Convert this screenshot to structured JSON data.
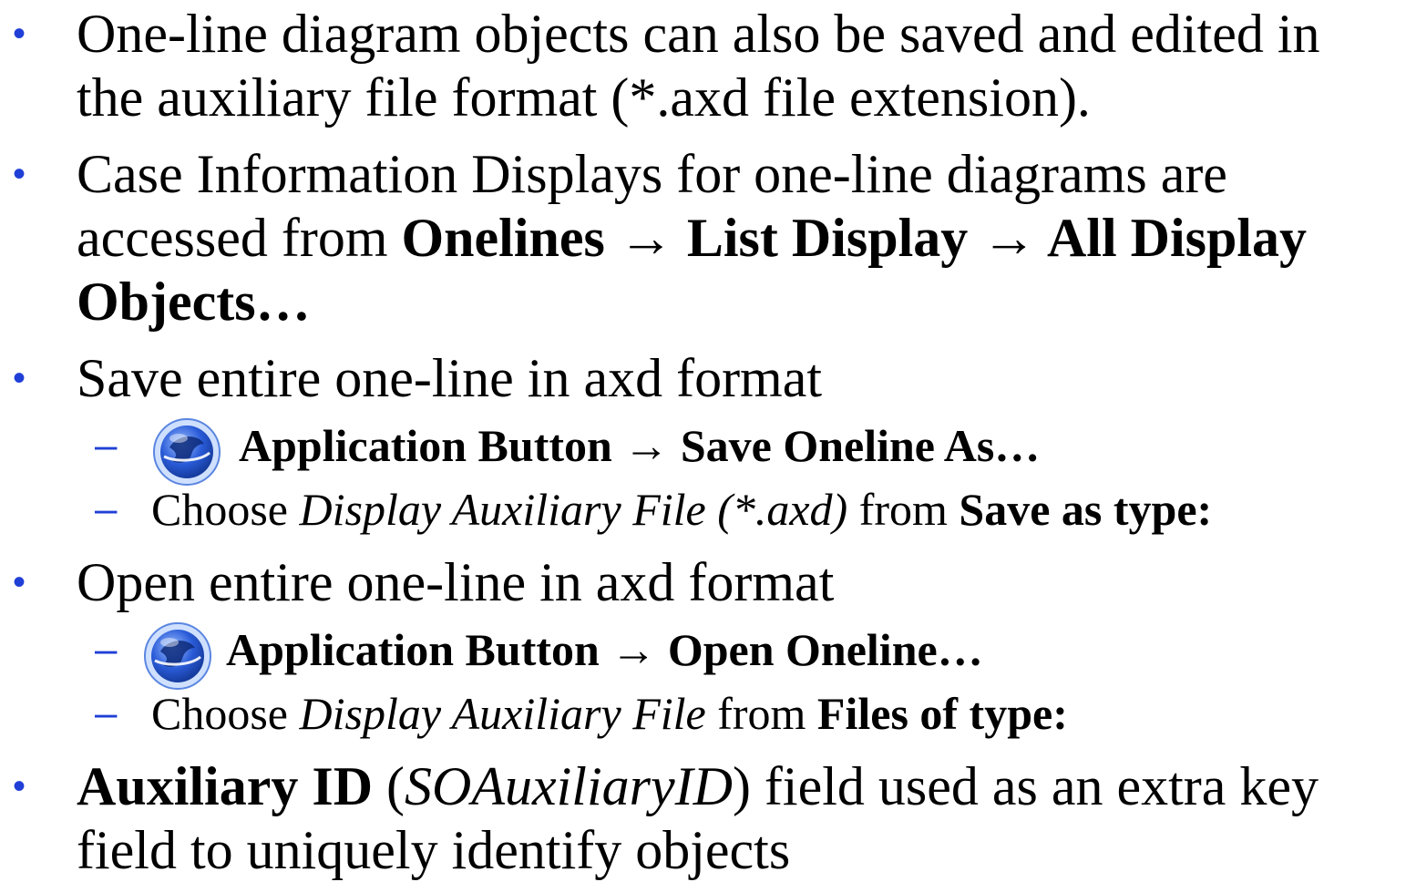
{
  "bullet_marker": "•",
  "sub_marker": "–",
  "colors": {
    "marker": "#1f3fd6",
    "icon_blue": "#2a5bd8",
    "icon_light": "#cfe0ff"
  },
  "bullet1": {
    "line1": "One-line diagram objects can also be saved and edited in",
    "line2": "the auxiliary file format (*.axd file extension)."
  },
  "bullet2": {
    "line1": "Case Information Displays for one-line diagrams are",
    "line2_plain": "accessed from ",
    "line2_bold1": "Onelines",
    "arrow": "→",
    "line2_bold2": "List Display",
    "line2_bold3": "All Display",
    "line3_bold": "Objects…"
  },
  "bullet3": {
    "text": "Save entire one-line in axd format",
    "sub1": {
      "icon": "application-button-icon",
      "bold1": "Application Button",
      "arrow": "→",
      "bold2": "Save Oneline As…"
    },
    "sub2": {
      "plain1": "Choose ",
      "italic": "Display Auxiliary File (*.axd)",
      "plain2": " from ",
      "bold": "Save as type:"
    }
  },
  "bullet4": {
    "text": "Open entire one-line in axd format",
    "sub1": {
      "icon": "application-button-icon",
      "bold1": "Application Button",
      "arrow": "→",
      "bold2": "Open Oneline…"
    },
    "sub2": {
      "plain1": "Choose ",
      "italic": "Display Auxiliary File",
      "plain2": " from ",
      "bold": "Files of type:"
    }
  },
  "bullet5": {
    "bold": "Auxiliary ID",
    "plain1": " (",
    "italic": "SOAuxiliaryID",
    "plain2": ") field used as an extra key",
    "line2": "field to uniquely identify objects"
  }
}
